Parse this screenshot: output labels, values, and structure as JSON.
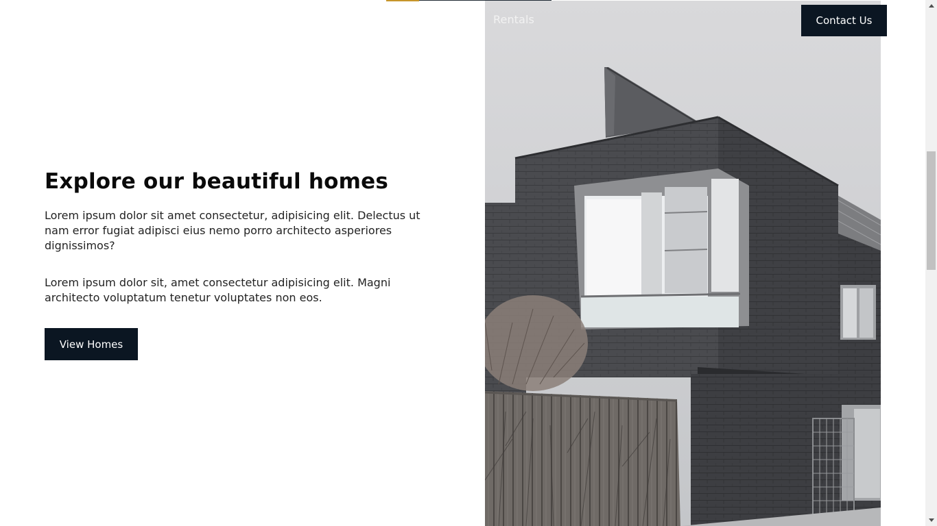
{
  "nav": {
    "rentals_label": "Rentals",
    "contact_label": "Contact Us"
  },
  "hero": {
    "title": "Explore our beautiful homes",
    "paragraph_1": "Lorem ipsum dolor sit amet consectetur, adipisicing elit. Delectus ut nam error fugiat adipisci eius nemo porro architecto asperiores dignissimos?",
    "paragraph_2": "Lorem ipsum dolor sit, amet consectetur adipisicing elit. Magni architecto voluptatum tenetur voluptates non eos.",
    "button_label": "View Homes"
  },
  "colors": {
    "primary_dark": "#0b1622",
    "accent": "#c7952b",
    "text": "#222222"
  },
  "icons": {
    "scroll_up": "chevron-up-icon",
    "scroll_down": "chevron-down-icon"
  }
}
